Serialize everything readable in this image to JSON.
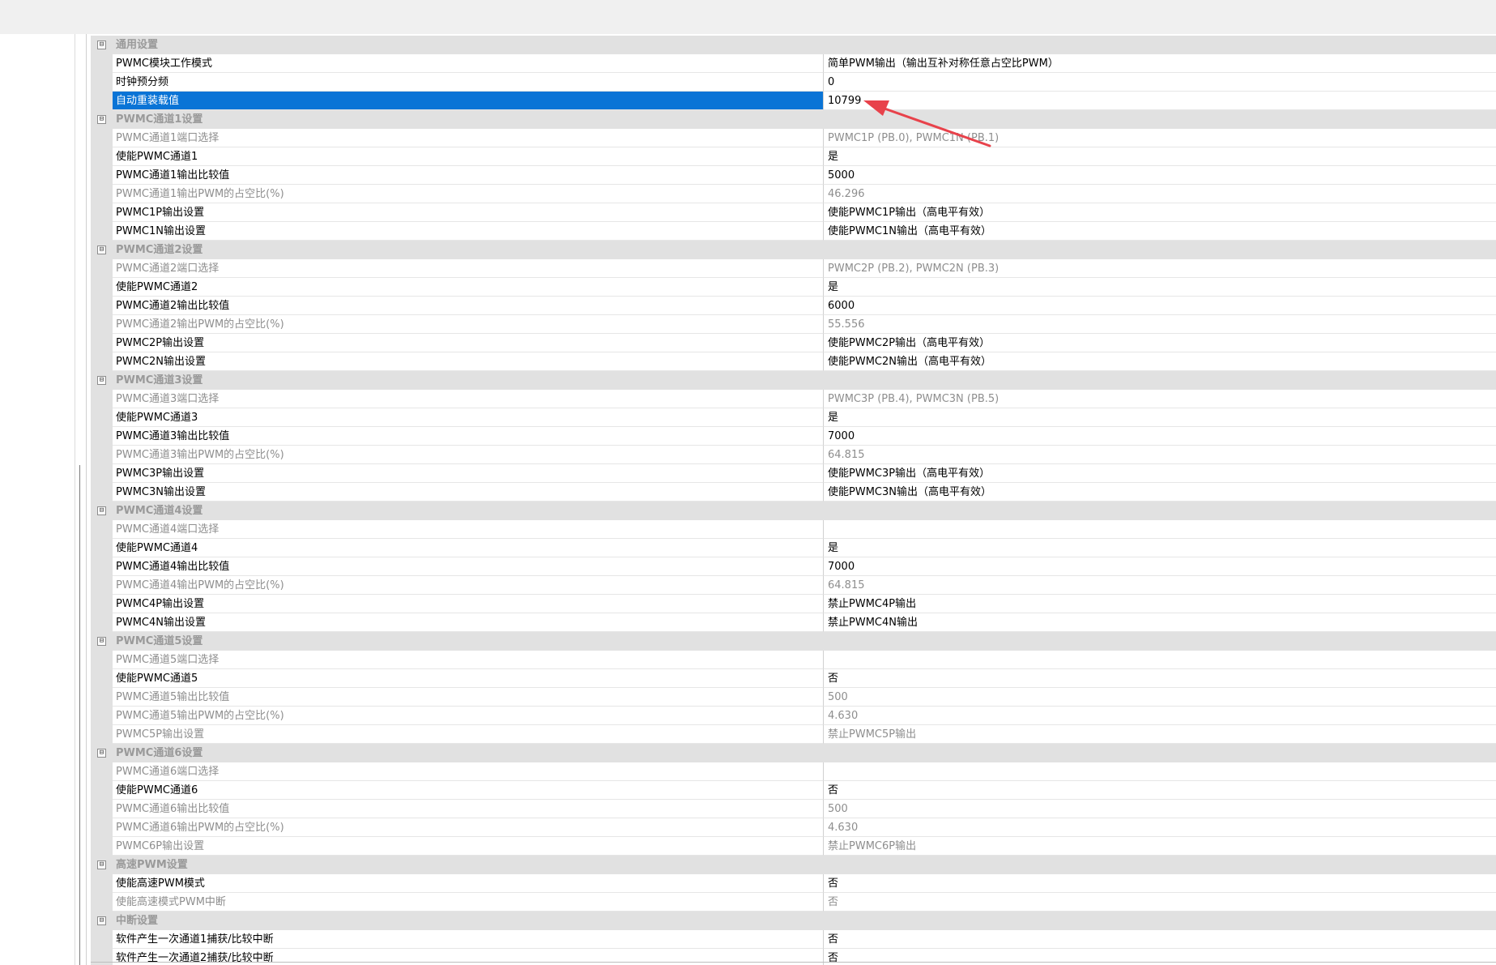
{
  "expander_glyph": "⊟",
  "sections": [
    {
      "title": "通用设置",
      "rows": [
        {
          "name": "PWMC模块工作模式",
          "value": "简单PWM输出（输出互补对称任意占空比PWM）",
          "ro": false
        },
        {
          "name": "时钟预分频",
          "value": "0",
          "ro": false
        },
        {
          "name": "自动重装载值",
          "value": "10799",
          "ro": false,
          "selected": true
        }
      ]
    },
    {
      "title": "PWMC通道1设置",
      "rows": [
        {
          "name": "PWMC通道1端口选择",
          "value": "PWMC1P (PB.0), PWMC1N (PB.1)",
          "ro": true
        },
        {
          "name": "使能PWMC通道1",
          "value": "是",
          "ro": false
        },
        {
          "name": "PWMC通道1输出比较值",
          "value": "5000",
          "ro": false
        },
        {
          "name": "PWMC通道1输出PWM的占空比(%)",
          "value": "46.296",
          "ro": true
        },
        {
          "name": "PWMC1P输出设置",
          "value": "使能PWMC1P输出（高电平有效）",
          "ro": false
        },
        {
          "name": "PWMC1N输出设置",
          "value": "使能PWMC1N输出（高电平有效）",
          "ro": false
        }
      ]
    },
    {
      "title": "PWMC通道2设置",
      "rows": [
        {
          "name": "PWMC通道2端口选择",
          "value": "PWMC2P (PB.2), PWMC2N (PB.3)",
          "ro": true
        },
        {
          "name": "使能PWMC通道2",
          "value": "是",
          "ro": false
        },
        {
          "name": "PWMC通道2输出比较值",
          "value": "6000",
          "ro": false
        },
        {
          "name": "PWMC通道2输出PWM的占空比(%)",
          "value": "55.556",
          "ro": true
        },
        {
          "name": "PWMC2P输出设置",
          "value": "使能PWMC2P输出（高电平有效）",
          "ro": false
        },
        {
          "name": "PWMC2N输出设置",
          "value": "使能PWMC2N输出（高电平有效）",
          "ro": false
        }
      ]
    },
    {
      "title": "PWMC通道3设置",
      "rows": [
        {
          "name": "PWMC通道3端口选择",
          "value": "PWMC3P (PB.4), PWMC3N (PB.5)",
          "ro": true
        },
        {
          "name": "使能PWMC通道3",
          "value": "是",
          "ro": false
        },
        {
          "name": "PWMC通道3输出比较值",
          "value": "7000",
          "ro": false
        },
        {
          "name": "PWMC通道3输出PWM的占空比(%)",
          "value": "64.815",
          "ro": true
        },
        {
          "name": "PWMC3P输出设置",
          "value": "使能PWMC3P输出（高电平有效）",
          "ro": false
        },
        {
          "name": "PWMC3N输出设置",
          "value": "使能PWMC3N输出（高电平有效）",
          "ro": false
        }
      ]
    },
    {
      "title": "PWMC通道4设置",
      "rows": [
        {
          "name": "PWMC通道4端口选择",
          "value": "",
          "ro": true
        },
        {
          "name": "使能PWMC通道4",
          "value": "是",
          "ro": false
        },
        {
          "name": "PWMC通道4输出比较值",
          "value": "7000",
          "ro": false
        },
        {
          "name": "PWMC通道4输出PWM的占空比(%)",
          "value": "64.815",
          "ro": true
        },
        {
          "name": "PWMC4P输出设置",
          "value": "禁止PWMC4P输出",
          "ro": false
        },
        {
          "name": "PWMC4N输出设置",
          "value": "禁止PWMC4N输出",
          "ro": false
        }
      ]
    },
    {
      "title": "PWMC通道5设置",
      "rows": [
        {
          "name": "PWMC通道5端口选择",
          "value": "",
          "ro": true
        },
        {
          "name": "使能PWMC通道5",
          "value": "否",
          "ro": false
        },
        {
          "name": "PWMC通道5输出比较值",
          "value": "500",
          "ro": true
        },
        {
          "name": "PWMC通道5输出PWM的占空比(%)",
          "value": "4.630",
          "ro": true
        },
        {
          "name": "PWMC5P输出设置",
          "value": "禁止PWMC5P输出",
          "ro": true
        }
      ]
    },
    {
      "title": "PWMC通道6设置",
      "rows": [
        {
          "name": "PWMC通道6端口选择",
          "value": "",
          "ro": true
        },
        {
          "name": "使能PWMC通道6",
          "value": "否",
          "ro": false
        },
        {
          "name": "PWMC通道6输出比较值",
          "value": "500",
          "ro": true
        },
        {
          "name": "PWMC通道6输出PWM的占空比(%)",
          "value": "4.630",
          "ro": true
        },
        {
          "name": "PWMC6P输出设置",
          "value": "禁止PWMC6P输出",
          "ro": true
        }
      ]
    },
    {
      "title": "高速PWM设置",
      "rows": [
        {
          "name": "使能高速PWM模式",
          "value": "否",
          "ro": false
        },
        {
          "name": "使能高速模式PWM中断",
          "value": "否",
          "ro": true
        }
      ]
    },
    {
      "title": "中断设置",
      "rows": [
        {
          "name": "软件产生一次通道1捕获/比较中断",
          "value": "否",
          "ro": false
        },
        {
          "name": "软件产生一次通道2捕获/比较中断",
          "value": "否",
          "ro": false
        }
      ]
    }
  ],
  "annotation": {
    "color": "#e8424b",
    "icon": "arrow-annotation"
  }
}
